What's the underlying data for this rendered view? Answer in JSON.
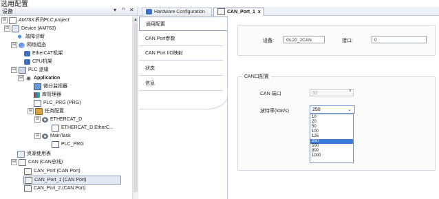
{
  "top_caption": "选用配置",
  "device_tree": {
    "title": "设备",
    "controls": {
      "dropdown": "▾",
      "pin": "ꟸ",
      "close": "✕"
    },
    "nodes": [
      {
        "label": "AM76X系列PLC.project",
        "expander": "⊟"
      },
      {
        "label": "Device (AM763)",
        "expander": "⊟"
      },
      {
        "label": "故障诊断",
        "expander": ""
      },
      {
        "label": "网络组态",
        "expander": "⊟"
      },
      {
        "label": "EtherCAT机架",
        "expander": ""
      },
      {
        "label": "CPU机架",
        "expander": ""
      },
      {
        "label": "PLC 逻辑",
        "expander": "⊟"
      },
      {
        "label": "Application",
        "expander": "⊟"
      },
      {
        "label": "微分监视器",
        "expander": ""
      },
      {
        "label": "库管理器",
        "expander": ""
      },
      {
        "label": "PLC_PRG (PRG)",
        "expander": ""
      },
      {
        "label": "任务配置",
        "expander": "⊟"
      },
      {
        "label": "ETHERCAT_D",
        "expander": "⊟"
      },
      {
        "label": "ETHERCAT_D.EtherC...",
        "expander": ""
      },
      {
        "label": "MainTask",
        "expander": "⊟"
      },
      {
        "label": "PLC_PRG",
        "expander": ""
      },
      {
        "label": "资源使用表",
        "expander": ""
      },
      {
        "label": "CAN (CAN总线)",
        "expander": "⊟"
      },
      {
        "label": "CAN_Port (CAN Port)",
        "expander": ""
      },
      {
        "label": "CAN_Port_1 (CAN Port)",
        "expander": ""
      },
      {
        "label": "CAN_Port_2 (CAN Port)",
        "expander": ""
      }
    ]
  },
  "tabs": [
    {
      "label": "Hardware Configuration"
    },
    {
      "label": "CAN_Port_1",
      "close": "x"
    }
  ],
  "side_nav": [
    {
      "label": "通用配置"
    },
    {
      "label": "CAN Port参数"
    },
    {
      "label": "CAN Port I/O映射"
    },
    {
      "label": "状态"
    },
    {
      "label": "信息"
    }
  ],
  "device_section": {
    "device_label": "设备:",
    "device_value": "GL20_2CAN",
    "interface_label": "接口:",
    "interface_value": "0"
  },
  "can_config": {
    "legend": "CAN口配置",
    "port_label": "CAN 端口",
    "port_value": "32",
    "baud_label": "波特率(kbit/s)",
    "baud_value": "250",
    "chevron": "⌄",
    "spin": "⬍",
    "options": [
      "10",
      "20",
      "50",
      "100",
      "125",
      "250",
      "500",
      "800",
      "1000"
    ],
    "selected_option": "250"
  },
  "colors": {
    "accent": "#3d79d6",
    "panel_border": "#b9c3d3"
  }
}
